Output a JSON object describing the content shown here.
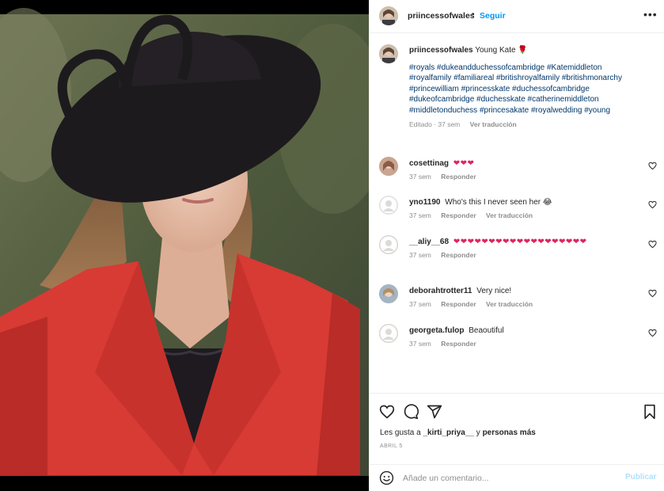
{
  "post": {
    "username": "priincessofwales",
    "follow_label": "Seguir",
    "more_label": "•••",
    "caption_text": "Young Kate 🌹",
    "hashtags": "#royals #dukeandduchessofcambridge #Katemiddleton #royalfamily #familiareal #britishroyalfamily #britishmonarchy #princewilliam #princesskate #duchessofcambridge #dukeofcambridge #duchesskate #catherinemiddleton #middletonduchess #princesakate #royalwedding #young",
    "caption_meta": {
      "edited": "Editado · 37 sem",
      "translate": "Ver traducción"
    }
  },
  "comments": [
    {
      "username": "cosettinag",
      "text": "",
      "hearts": "❤❤❤",
      "time": "37 sem",
      "reply": "Responder",
      "translate": ""
    },
    {
      "username": "yno1190",
      "text": "Who's this I never seen her 😂",
      "hearts": "",
      "time": "37 sem",
      "reply": "Responder",
      "translate": "Ver traducción"
    },
    {
      "username": "__aliy__68",
      "text": "",
      "hearts": "❤❤❤❤❤❤❤❤❤❤❤❤❤❤❤❤❤❤❤",
      "time": "37 sem",
      "reply": "Responder",
      "translate": ""
    },
    {
      "username": "deborahtrotter11",
      "text": "Very nice!",
      "hearts": "",
      "time": "37 sem",
      "reply": "Responder",
      "translate": "Ver traducción"
    },
    {
      "username": "georgeta.fulop",
      "text": "Beaoutiful",
      "hearts": "",
      "time": "37 sem",
      "reply": "Responder",
      "translate": ""
    }
  ],
  "likes": {
    "prefix": "Les gusta a",
    "user": "_kirti_priya__",
    "joiner": "y",
    "others": "personas más"
  },
  "date": "ABRIL 5",
  "composer": {
    "placeholder": "Añade un comentario...",
    "publish_label": "Publicar"
  },
  "colors": {
    "link": "#00376b",
    "accent": "#0095f6",
    "heart": "#e0245e",
    "coat": "#d83a34",
    "hat": "#1d1a1e"
  }
}
